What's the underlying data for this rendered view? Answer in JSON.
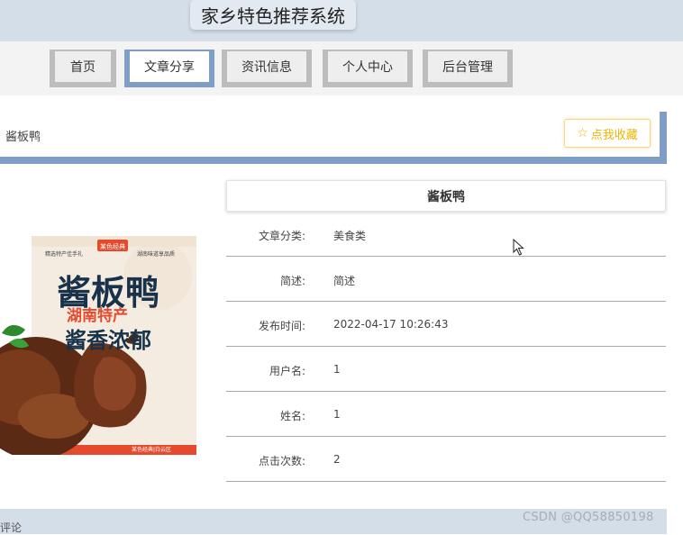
{
  "header": {
    "title": "家乡特色推荐系统"
  },
  "nav": {
    "items": [
      {
        "label": "首页"
      },
      {
        "label": "文章分享"
      },
      {
        "label": "资讯信息"
      },
      {
        "label": "个人中心"
      },
      {
        "label": "后台管理"
      }
    ],
    "active_index": 1
  },
  "breadcrumb": {
    "current": "酱板鸭"
  },
  "favorite": {
    "label": "点我收藏",
    "icon": "star-outline-icon"
  },
  "product_image": {
    "headline": "酱板鸭",
    "subline": "湖南特产",
    "tagline": "酱香浓郁",
    "tag_left": "精选特产佳手礼",
    "tag_right": "湖南味道享品质",
    "brand_badge": "某色经典"
  },
  "detail": {
    "title": "酱板鸭",
    "fields": [
      {
        "label": "文章分类:",
        "value": "美食类"
      },
      {
        "label": "简述:",
        "value": "简述"
      },
      {
        "label": "发布时间:",
        "value": "2022-04-17 10:26:43"
      },
      {
        "label": "用户名:",
        "value": "1"
      },
      {
        "label": "姓名:",
        "value": "1"
      },
      {
        "label": "点击次数:",
        "value": "2"
      }
    ]
  },
  "comments": {
    "label": "评论"
  },
  "watermark": {
    "text": "CSDN @QQ58850198"
  },
  "colors": {
    "header_band": "#d4dee9",
    "nav_active_border": "#7f9ec5",
    "nav_inactive_border": "#bdbdbd",
    "favorite_accent": "#f0b400",
    "row_divider": "#a9a9a9"
  }
}
